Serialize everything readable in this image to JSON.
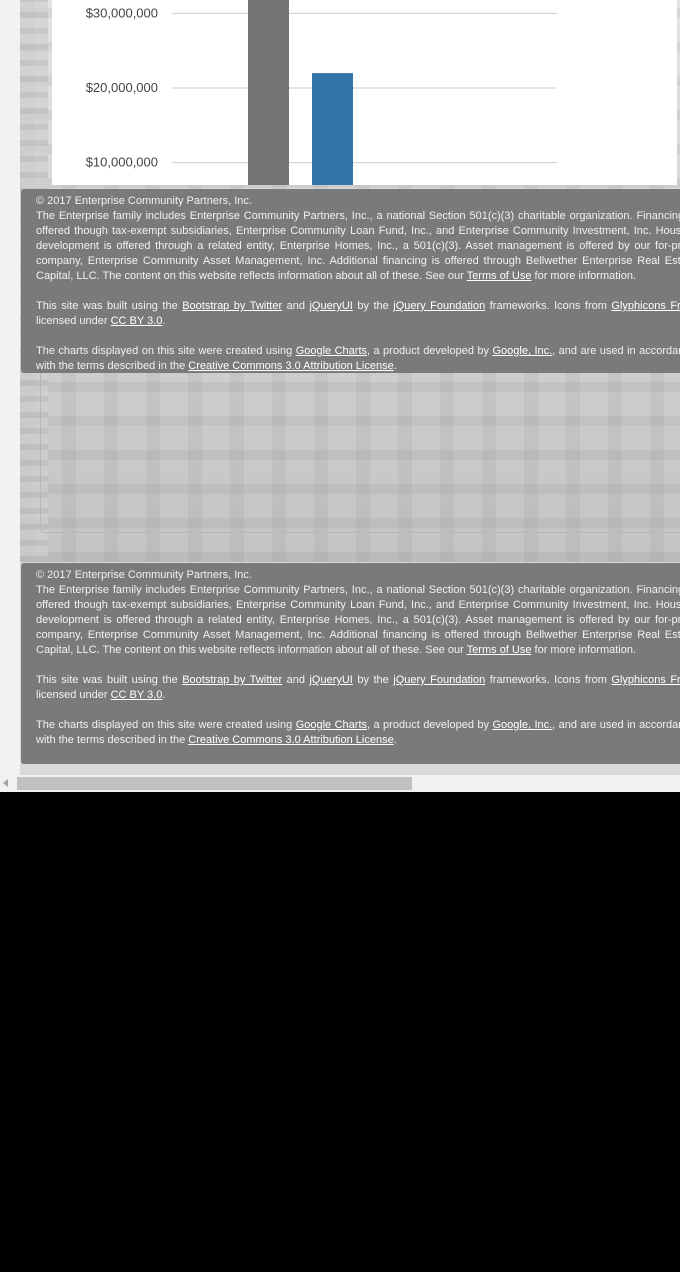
{
  "chart_data": {
    "type": "bar",
    "title": "",
    "xlabel": "",
    "ylabel": "",
    "yticks": [
      "$30,000,000",
      "$20,000,000",
      "$10,000,000"
    ],
    "series": [
      {
        "values": [
          33000000
        ],
        "color": "#757575"
      },
      {
        "values": [
          22000000
        ],
        "color": "#3375a8"
      }
    ],
    "visible_ylim": [
      7000000,
      31800000
    ],
    "grid": true
  },
  "footer": {
    "copyright": "© 2017 Enterprise Community Partners, Inc.",
    "p1": {
      "text_a": "The Enterprise family includes Enterprise Community Partners, Inc., a national Section 501(c)(3) charitable organization. Financing is offered though tax-exempt subsidiaries, Enterprise Community Loan Fund, Inc., and Enterprise Community Investment, Inc. Housing development is offered through a related entity, Enterprise Homes, Inc., a 501(c)(3). Asset management is offered by our for-profit company, Enterprise Community Asset Management, Inc. Additional financing is offered through Bellwether Enterprise Real Estate Capital, LLC. The content on this website reflects information about all of these. See our ",
      "link_terms": "Terms of Use",
      "text_b": " for more information."
    },
    "p2": {
      "text_a": "This site was built using the ",
      "link_bootstrap": "Bootstrap by Twitter",
      "text_b": " and ",
      "link_jqueryui": "jQueryUI",
      "text_c": " by the ",
      "link_jquery_foundation": "jQuery Foundation",
      "text_d": " frameworks. Icons from ",
      "link_glyphicons": "Glyphicons Free",
      "text_e": ", licensed under ",
      "link_ccby": "CC BY 3.0",
      "text_f": "."
    },
    "p3": {
      "text_a": "The charts displayed on this site were created using ",
      "link_google_charts": "Google Charts",
      "text_b": ", a product developed by ",
      "link_google": "Google, Inc.",
      "text_c": ", and are used in accordance with the terms described in the ",
      "link_cc": "Creative Commons 3.0 Attribution License",
      "text_d": "."
    }
  }
}
